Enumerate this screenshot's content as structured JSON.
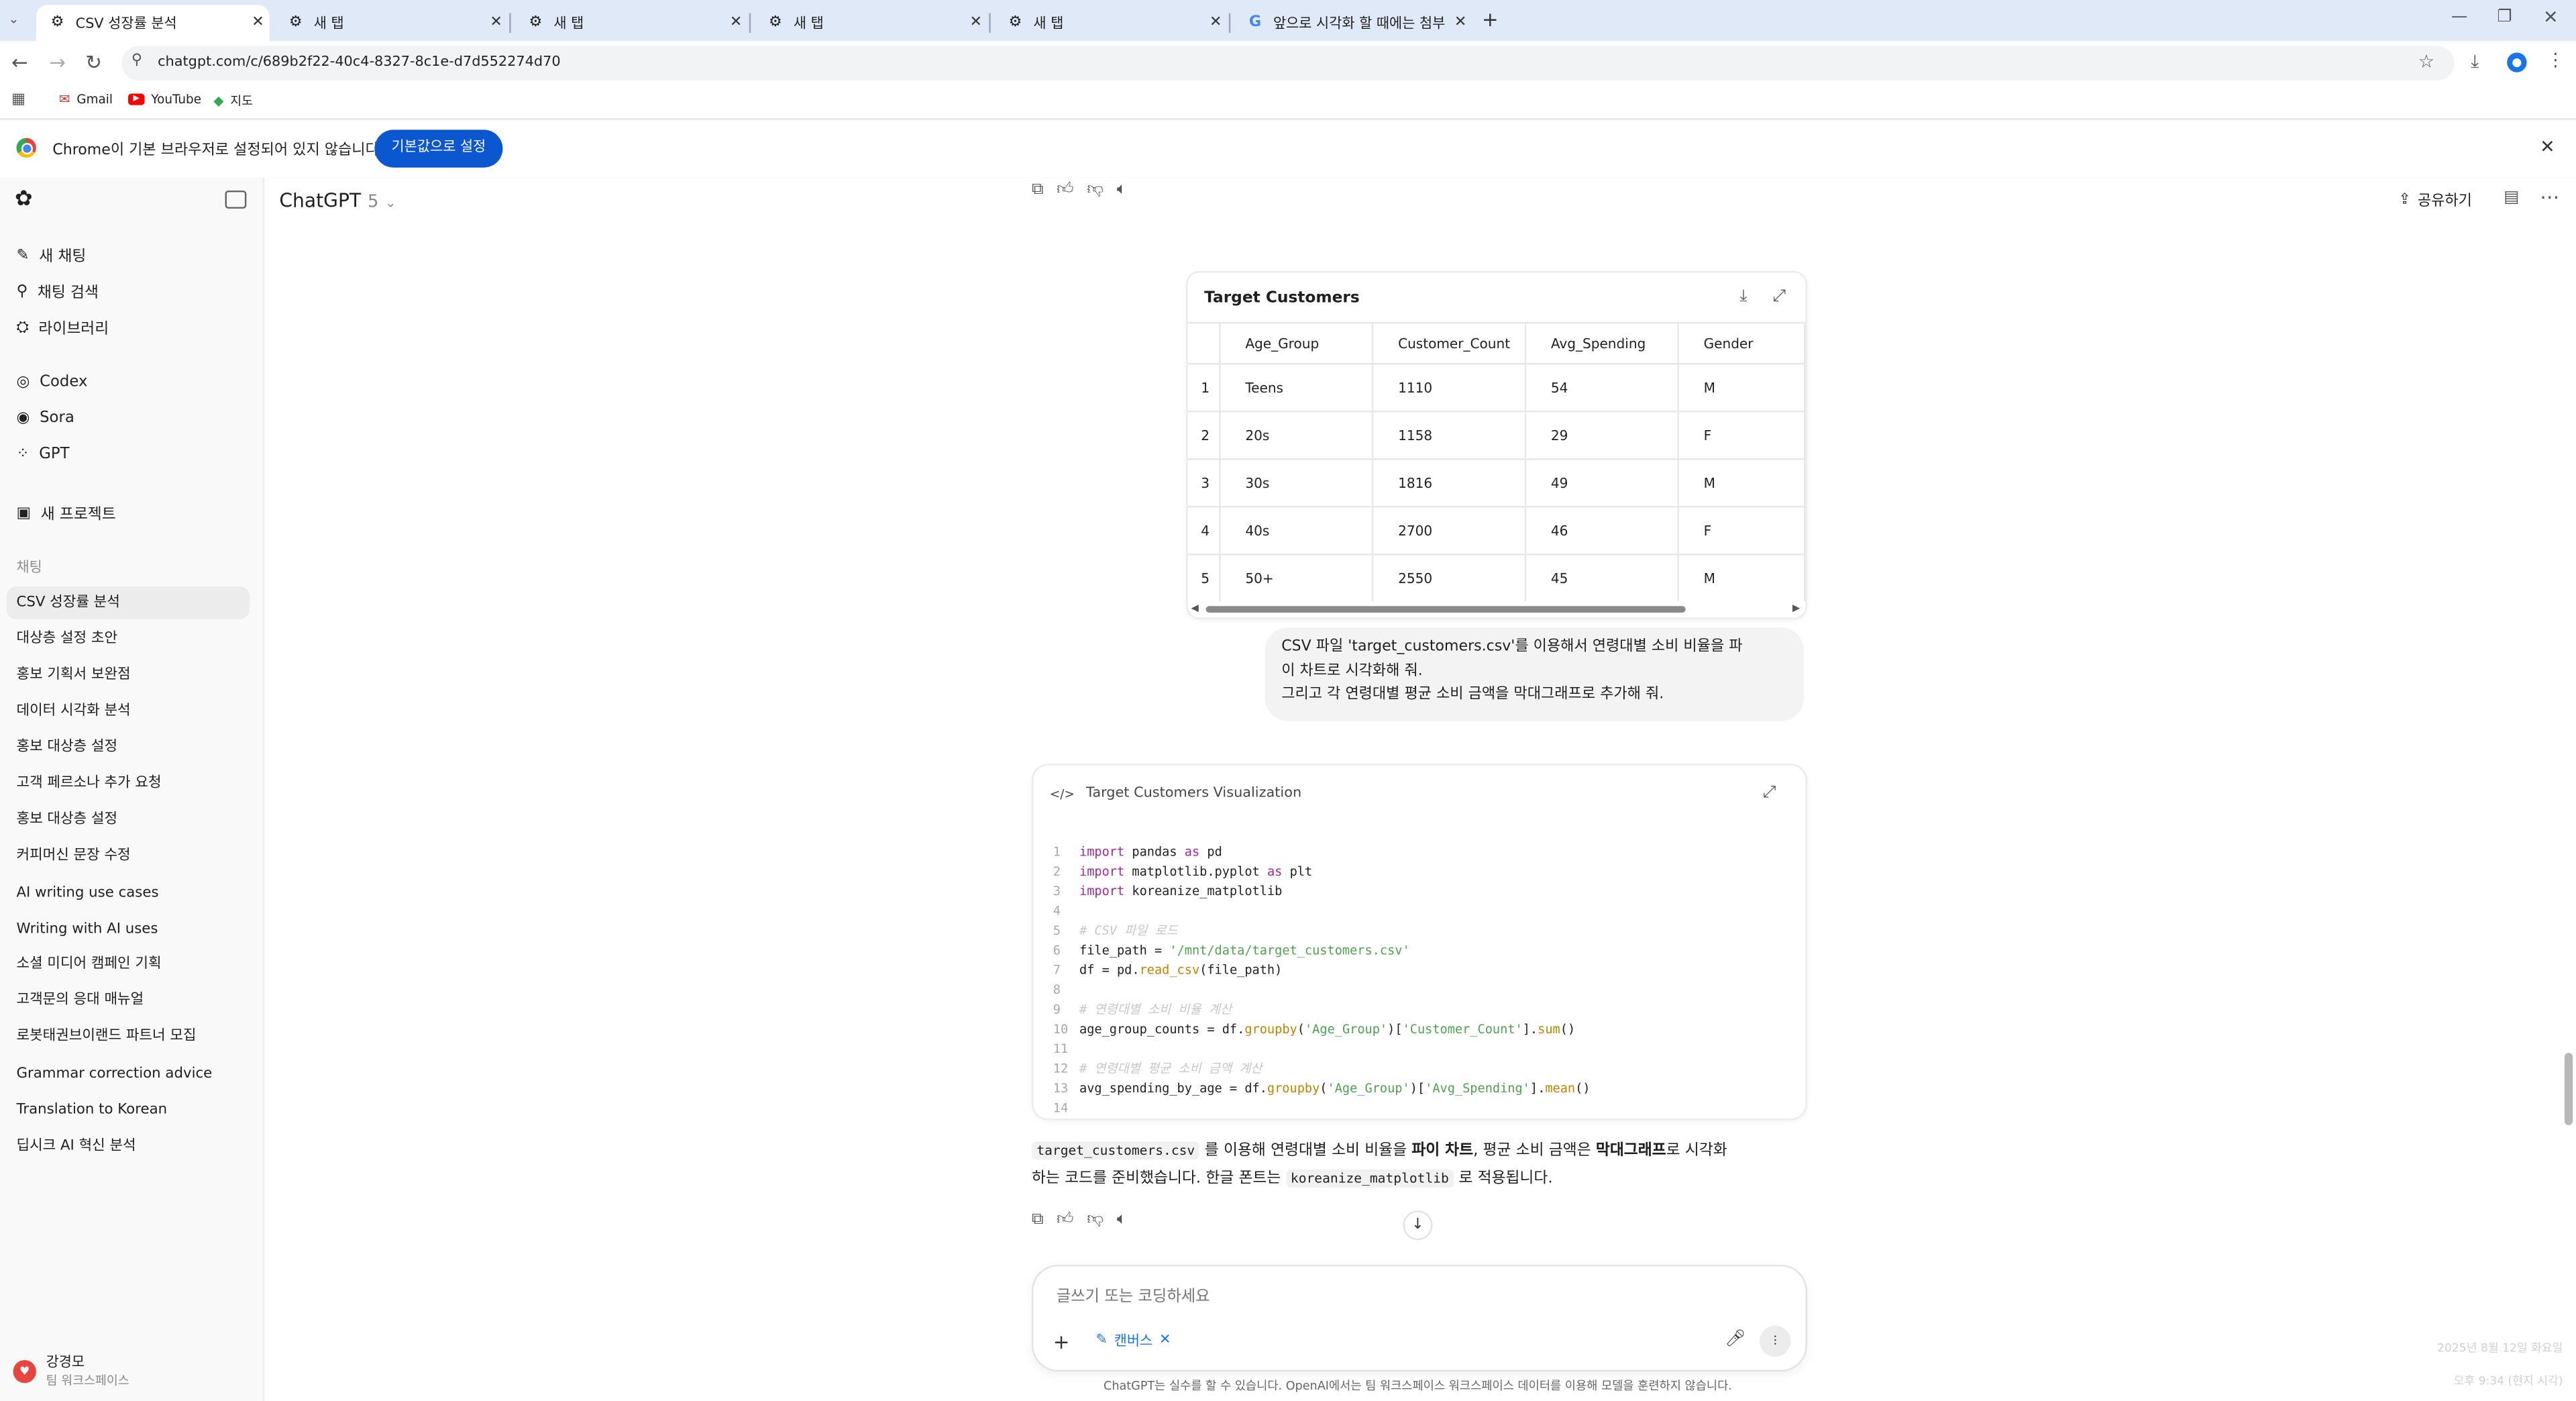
{
  "browser": {
    "tabs": [
      {
        "title": "CSV 성장률 분석",
        "active": true
      },
      {
        "title": "새 탭",
        "active": false
      },
      {
        "title": "새 탭",
        "active": false
      },
      {
        "title": "새 탭",
        "active": false
      },
      {
        "title": "새 탭",
        "active": false
      },
      {
        "title": "앞으로 시각화 할 때에는 첨부",
        "active": false
      }
    ],
    "url": "chatgpt.com/c/689b2f22-40c4-8327-8c1e-d7d552274d70",
    "bookmarks": [
      "Gmail",
      "YouTube",
      "지도"
    ],
    "infobar": {
      "message": "Chrome이 기본 브라우저로 설정되어 있지 않습니다",
      "button": "기본값으로 설정"
    }
  },
  "sidebar": {
    "nav": [
      {
        "label": "새 채팅",
        "icon": "edit-icon"
      },
      {
        "label": "채팅 검색",
        "icon": "search-icon"
      },
      {
        "label": "라이브러리",
        "icon": "library-icon"
      },
      {
        "label": "Codex",
        "icon": "codex-icon"
      },
      {
        "label": "Sora",
        "icon": "sora-icon"
      },
      {
        "label": "GPT",
        "icon": "grid-icon"
      },
      {
        "label": "새 프로젝트",
        "icon": "folder-plus-icon"
      }
    ],
    "section_label": "채팅",
    "chats": [
      "CSV 성장률 분석",
      "대상층 설정 초안",
      "홍보 기획서 보완점",
      "데이터 시각화 분석",
      "홍보 대상층 설정",
      "고객 페르소나 추가 요청",
      "홍보 대상층 설정",
      "커피머신 문장 수정",
      "AI writing use cases",
      "Writing with AI uses",
      "소셜 미디어 캠페인 기획",
      "고객문의 응대 매뉴얼",
      "로봇태권브이랜드 파트너 모집",
      "Grammar correction advice",
      "Translation to Korean",
      "딥시크 AI 혁신 분석"
    ],
    "user": {
      "name": "강경모",
      "workspace": "팀 워크스페이스"
    }
  },
  "header": {
    "model": "ChatGPT",
    "version": "5",
    "share": "공유하기"
  },
  "table": {
    "title": "Target Customers",
    "columns": [
      "Age_Group",
      "Customer_Count",
      "Avg_Spending",
      "Gender"
    ],
    "rows": [
      {
        "n": "1",
        "cells": [
          "Teens",
          "1110",
          "54",
          "M"
        ]
      },
      {
        "n": "2",
        "cells": [
          "20s",
          "1158",
          "29",
          "F"
        ]
      },
      {
        "n": "3",
        "cells": [
          "30s",
          "1816",
          "49",
          "M"
        ]
      },
      {
        "n": "4",
        "cells": [
          "40s",
          "2700",
          "46",
          "F"
        ]
      },
      {
        "n": "5",
        "cells": [
          "50+",
          "2550",
          "45",
          "M"
        ]
      }
    ]
  },
  "user_message": {
    "line1": "CSV 파일 'target_customers.csv'를 이용해서 연령대별 소비 비율을 파",
    "line2": "이 차트로 시각화해 줘.",
    "line3": "그리고 각 연령대별 평균 소비 금액을 막대그래프로 추가해 줘."
  },
  "code_panel": {
    "title": "Target Customers Visualization",
    "lines": [
      "import pandas as pd",
      "import matplotlib.pyplot as plt",
      "import koreanize_matplotlib",
      "",
      "# CSV 파일 로드",
      "file_path = '/mnt/data/target_customers.csv'",
      "df = pd.read_csv(file_path)",
      "",
      "# 연령대별 소비 비율 계산",
      "age_group_counts = df.groupby('Age_Group')['Customer_Count'].sum()",
      "",
      "# 연령대별 평균 소비 금액 계산",
      "avg_spending_by_age = df.groupby('Age_Group')['Avg_Spending'].mean()",
      ""
    ]
  },
  "assistant": {
    "code1": "target_customers.csv",
    "t1": " 를 이용해 연령대별 소비 비율을 ",
    "b1": "파이 차트",
    "t2": ", 평균 소비 금액은 ",
    "b2": "막대그래프",
    "t3": "로 시각화",
    "t4": "하는 코드를 준비했습니다. 한글 폰트는 ",
    "code2": "koreanize_matplotlib",
    "t5": " 로 적용됩니다."
  },
  "composer": {
    "placeholder": "글쓰기 또는 코딩하세요",
    "canvas": "캔버스"
  },
  "footer": "ChatGPT는 실수를 할 수 있습니다. OpenAI에서는 팀 워크스페이스 워크스페이스 데이터를 이용해 모델을 훈련하지 않습니다.",
  "clock": {
    "date": "2025년 8월 12일 화요일",
    "time": "오후 9:34 (현지 시각)"
  }
}
